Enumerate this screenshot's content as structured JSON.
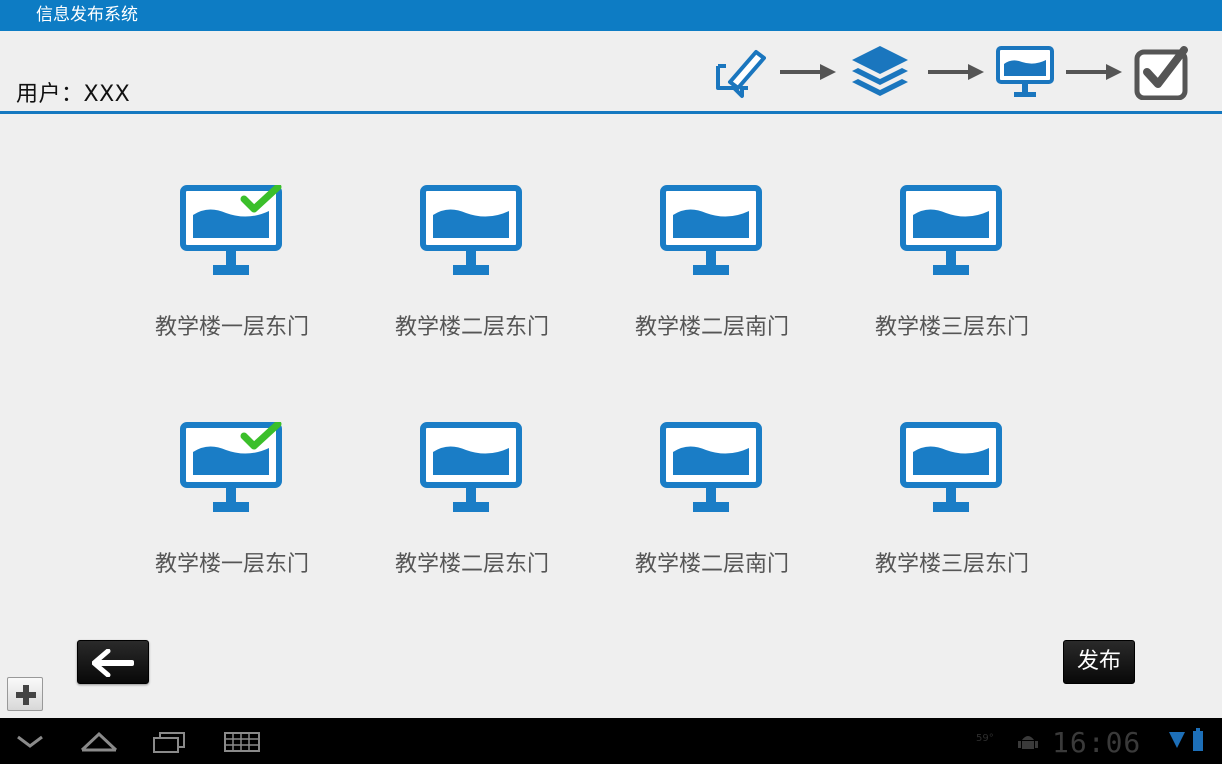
{
  "app": {
    "title": "信息发布系统"
  },
  "header": {
    "user_label": "用户：XXX"
  },
  "steps": [
    {
      "icon": "edit-note-icon"
    },
    {
      "icon": "layers-icon"
    },
    {
      "icon": "monitor-icon"
    },
    {
      "icon": "checkbox-checked-icon"
    }
  ],
  "terminals": [
    {
      "label": "教学楼一层东门",
      "selected": true
    },
    {
      "label": "教学楼二层东门",
      "selected": false
    },
    {
      "label": "教学楼二层南门",
      "selected": false
    },
    {
      "label": "教学楼三层东门",
      "selected": false
    },
    {
      "label": "教学楼一层东门",
      "selected": true
    },
    {
      "label": "教学楼二层东门",
      "selected": false
    },
    {
      "label": "教学楼二层南门",
      "selected": false
    },
    {
      "label": "教学楼三层东门",
      "selected": false
    }
  ],
  "actions": {
    "back_icon": "arrow-left-icon",
    "publish_label": "发布",
    "add_icon": "plus-icon"
  },
  "system_bar": {
    "time": "16:06",
    "temperature": "59°",
    "icons": [
      "back-icon",
      "home-icon",
      "recent-apps-icon",
      "keyboard-icon",
      "android-debug-icon",
      "wifi-icon",
      "battery-icon"
    ]
  },
  "colors": {
    "accent": "#0d7cc4",
    "check": "#3bbf2a"
  }
}
